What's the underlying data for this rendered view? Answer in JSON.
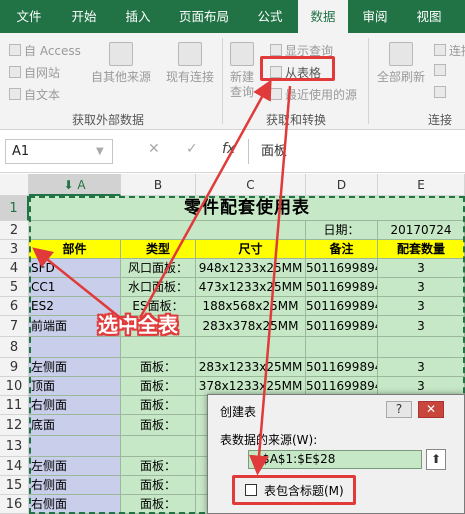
{
  "ribbon_tabs": [
    "文件",
    "开始",
    "插入",
    "页面布局",
    "公式",
    "数据",
    "审阅",
    "视图"
  ],
  "ribbon": {
    "get_external": {
      "access": "自 Access",
      "web": "自网站",
      "text": "自文本",
      "other": "自其他来源",
      "existing": "现有连接",
      "group_label": "获取外部数据"
    },
    "get_transform": {
      "new_query_line1": "新建",
      "new_query_line2": "查询",
      "show_queries": "显示查询",
      "from_table": "从表格",
      "recent_sources": "最近使用的源",
      "group_label": "获取和转换"
    },
    "connections": {
      "refresh_line1": "全部刷新",
      "connections_label": "连接",
      "group_label": "连接"
    }
  },
  "formula_bar": {
    "name_box": "A1",
    "cancel": "✕",
    "enter": "✓",
    "fx": "fx",
    "content": "面板"
  },
  "columns": [
    "A",
    "B",
    "C",
    "D",
    "E"
  ],
  "rows": [
    "1",
    "2",
    "3",
    "4",
    "5",
    "6",
    "7",
    "8",
    "9",
    "10",
    "11",
    "12",
    "13",
    "14",
    "15",
    "16"
  ],
  "sheet": {
    "title": "零件配套使用表",
    "date_label": "日期：",
    "date_value": "20170724",
    "headers": [
      "部件",
      "类型",
      "尺寸",
      "备注",
      "配套数量"
    ],
    "data_rows": [
      [
        "SFD",
        "风口面板",
        "948x1233x25MM",
        "5011699894",
        "3"
      ],
      [
        "CC1",
        "水口面板",
        "473x1233x25MM",
        "5011699894",
        "3"
      ],
      [
        "ES2",
        "ES面板",
        "188x568x25MM",
        "5011699894",
        "3"
      ],
      [
        "前端面",
        "",
        "283x378x25MM",
        "5011699894",
        "3"
      ],
      [
        "",
        "",
        "",
        "",
        ""
      ],
      [
        "左侧面",
        "面板",
        "283x1233x25MM",
        "5011699894",
        "3"
      ],
      [
        "顶面",
        "面板",
        "378x1233x25MM",
        "5011699894",
        "3"
      ],
      [
        "右侧面",
        "面板",
        "",
        "",
        ""
      ],
      [
        "底面",
        "面板",
        "",
        "",
        ""
      ],
      [
        "",
        "",
        "",
        "",
        ""
      ],
      [
        "左侧面",
        "面板",
        "",
        "",
        ""
      ],
      [
        "右侧面",
        "面板",
        "",
        "",
        ""
      ],
      [
        "右侧面",
        "面板",
        "",
        "",
        ""
      ]
    ]
  },
  "callout": "选中全表",
  "dialog": {
    "title": "创建表",
    "help": "?",
    "close": "✕",
    "source_label": "表数据的来源(W):",
    "source_value": "=$A$1:$E$28",
    "collapse": "⬆",
    "has_headers": "表包含标题(M)"
  },
  "colors": {
    "excel_green": "#217346",
    "highlight_red": "#e03a3a",
    "sheet_green": "#c6e8c6",
    "header_yellow": "#ffff00",
    "first_col_blue": "#c9cfea"
  }
}
